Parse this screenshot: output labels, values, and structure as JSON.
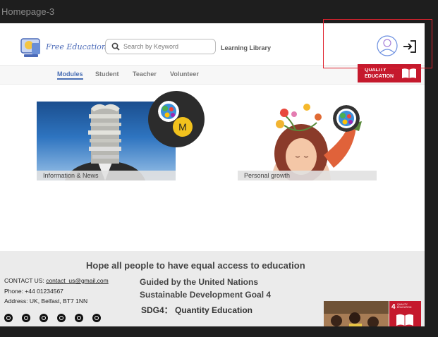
{
  "frame_title": "Homepage-3",
  "header": {
    "brand": "Free Education",
    "search_placeholder": "Search by Keyword",
    "library_link": "Learning Library"
  },
  "nav": {
    "items": [
      {
        "label": "Modules",
        "active": true
      },
      {
        "label": "Student",
        "active": false
      },
      {
        "label": "Teacher",
        "active": false
      },
      {
        "label": "Volunteer",
        "active": false
      }
    ],
    "banner_line1": "QUALITY",
    "banner_line2": "EDUCATION"
  },
  "cards": [
    {
      "caption": "Information & News"
    },
    {
      "caption": "Personal growth"
    }
  ],
  "user_initial": "M",
  "footer": {
    "tagline": "Hope all people to have equal access to education",
    "contact_label": "CONTACT US:",
    "contact_email": "contact_us@gmail.com",
    "phone": "Phone: +44 01234567",
    "address": "Address: UK, Belfast, BT7 1NN",
    "guide_line1": "Guided by the United Nations",
    "guide_line2": "Sustainable Development Goal 4",
    "sdg_label": "SDG4： Quantity Education",
    "sdg_badge_number": "4",
    "sdg_badge_text": "QUALITY EDUCATION"
  },
  "social_icons": [
    "facebook-icon",
    "instagram-icon",
    "twitter-icon",
    "youtube-icon",
    "snapchat-icon",
    "tiktok-icon"
  ],
  "colors": {
    "accent_blue": "#4a6fb5",
    "sdg_red": "#c5192d",
    "highlight_red": "#e0232f",
    "avatar_yellow": "#f2c21d"
  }
}
